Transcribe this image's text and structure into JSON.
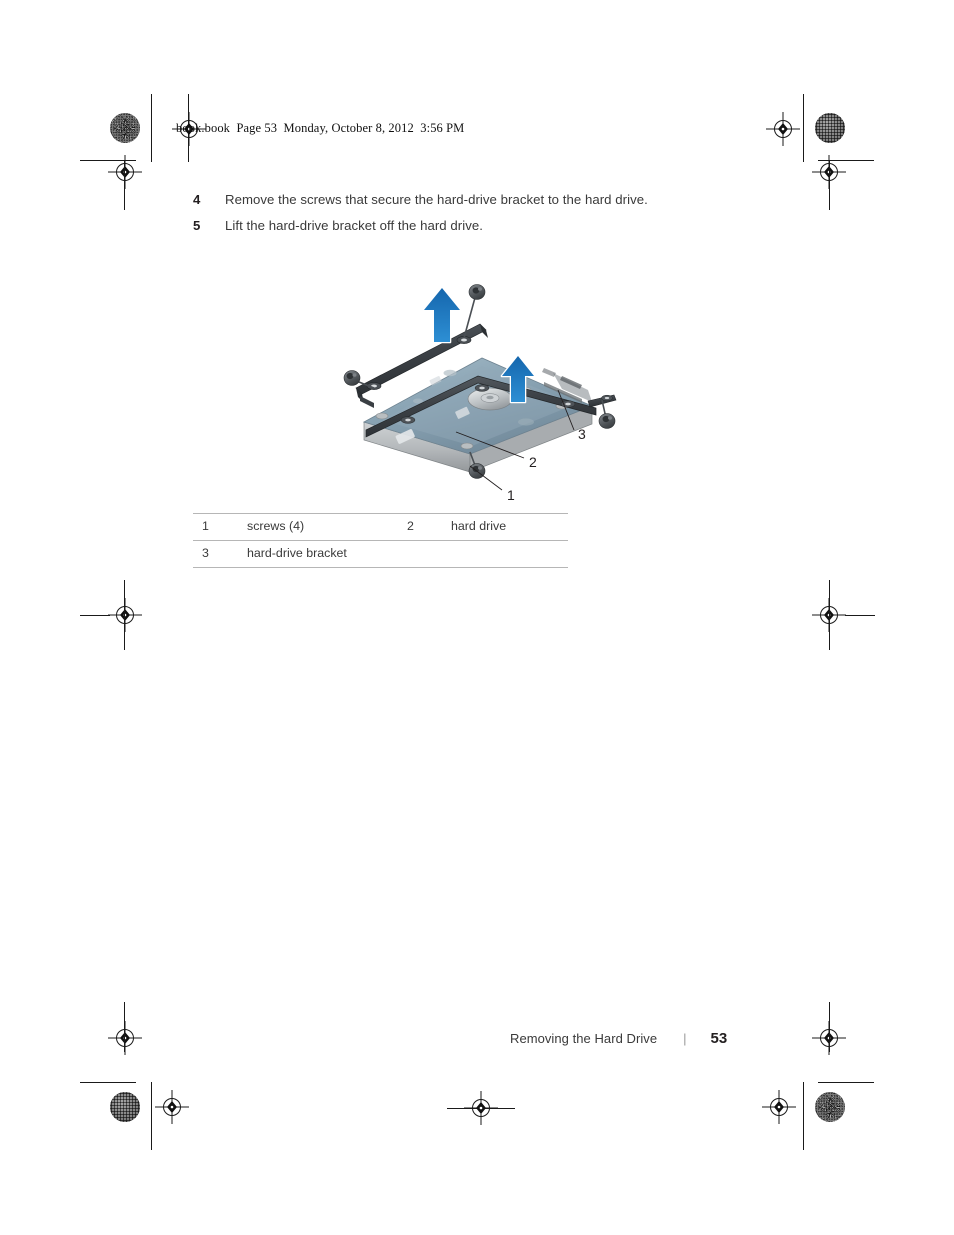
{
  "header": {
    "text": "book.book  Page 53  Monday, October 8, 2012  3:56 PM"
  },
  "steps": [
    {
      "num": "4",
      "text": "Remove the screws that secure the hard-drive bracket to the hard drive."
    },
    {
      "num": "5",
      "text": "Lift the hard-drive bracket off the hard drive."
    }
  ],
  "figure": {
    "callouts": [
      {
        "id": "1",
        "label": "1"
      },
      {
        "id": "2",
        "label": "2"
      },
      {
        "id": "3",
        "label": "3"
      }
    ],
    "colors": {
      "arrow_blue": "#1c75bc",
      "arrow_outline": "#ffffff",
      "drive_pcb": "#8fa8b8",
      "drive_pcb_dark": "#6e8391",
      "bracket_dark": "#3f4449",
      "drive_side": "#b9bcbe",
      "screw": "#54585c",
      "leader_line": "#231f20"
    }
  },
  "legend": {
    "rows": [
      {
        "num": "1",
        "label": "screws (4)",
        "num2": "2",
        "label2": "hard drive"
      },
      {
        "num": "3",
        "label": "hard-drive bracket",
        "num2": "",
        "label2": ""
      }
    ]
  },
  "footer": {
    "title": "Removing the Hard Drive",
    "separator": "|",
    "page": "53"
  }
}
